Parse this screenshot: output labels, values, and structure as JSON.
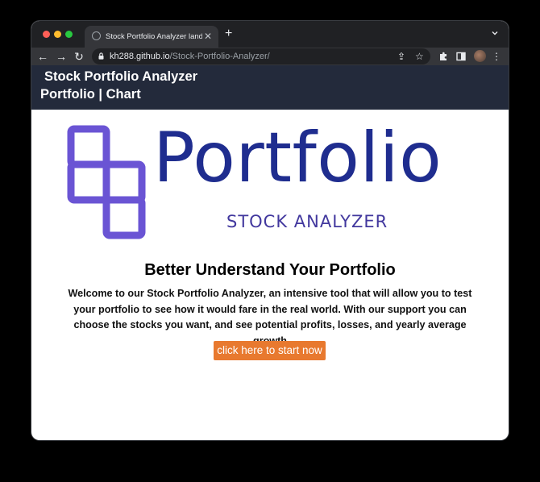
{
  "browser": {
    "tab_title": "Stock Portfolio Analyzer landing",
    "tab_close_glyph": "✕",
    "new_tab_glyph": "+",
    "url_host": "kh288.github.io",
    "url_path": "/Stock-Portfolio-Analyzer/",
    "icons": {
      "back": "←",
      "forward": "→",
      "reload": "↻",
      "share": "⇪",
      "bookmark": "☆",
      "extensions": "puzzle",
      "sidepanel": "sidepanel",
      "menu": "⋮"
    }
  },
  "site": {
    "title": "Stock Portfolio Analyzer",
    "nav": {
      "portfolio": "Portfolio",
      "separator": " | ",
      "chart": "Chart"
    },
    "logo": {
      "word": "Portfolio",
      "subtitle": "STOCK ANALYZER"
    },
    "headline": "Better Understand Your Portfolio",
    "welcome": "Welcome to our Stock Portfolio Analyzer, an intensive tool that will allow you to test your portfolio to see how it would fare in the real world. With our support you can choose the stocks you want, and see potential profits, losses, and yearly average growth",
    "cta_label": "click here to start now"
  },
  "colors": {
    "nav_bg": "#232a3b",
    "logo_blocks": "#6a54d4",
    "logo_word": "#1f2d8f",
    "logo_sub": "#42389e",
    "cta_bg": "#e8792f"
  }
}
